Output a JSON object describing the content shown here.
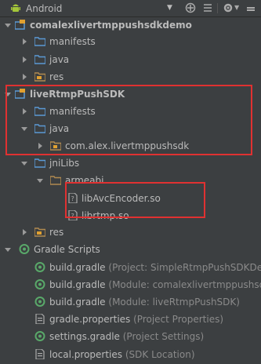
{
  "toolbar": {
    "view_label": "Android",
    "view_icon": "android-icon",
    "icons": [
      "sync-icon",
      "collapse-all-icon",
      "settings-icon",
      "hide-panel-icon"
    ]
  },
  "tree": {
    "rows": [
      {
        "label": "comalexlivertmppushsdkdemo",
        "hint": "",
        "bold": true,
        "icon": "module-icon"
      },
      {
        "label": "manifests",
        "hint": "",
        "icon": "folder-icon"
      },
      {
        "label": "java",
        "hint": "",
        "icon": "folder-icon"
      },
      {
        "label": "res",
        "hint": "",
        "icon": "res-folder-icon"
      },
      {
        "label": "liveRtmpPushSDK",
        "hint": "",
        "bold": true,
        "icon": "module-icon"
      },
      {
        "label": "manifests",
        "hint": "",
        "icon": "folder-icon"
      },
      {
        "label": "java",
        "hint": "",
        "icon": "folder-icon"
      },
      {
        "label": "com.alex.livertmppushsdk",
        "hint": "",
        "icon": "package-icon"
      },
      {
        "label": "jniLibs",
        "hint": "",
        "icon": "folder-icon"
      },
      {
        "label": "armeabi",
        "hint": "",
        "icon": "folder-icon"
      },
      {
        "label": "libAvcEncoder.so",
        "hint": "",
        "icon": "file-icon"
      },
      {
        "label": "librtmp.so",
        "hint": "",
        "icon": "file-icon"
      },
      {
        "label": "res",
        "hint": "",
        "icon": "res-folder-icon"
      },
      {
        "label": "Gradle Scripts",
        "hint": "",
        "icon": "gradle-icon"
      },
      {
        "label": "build.gradle",
        "hint": "(Project: SimpleRtmpPushSDKDem",
        "icon": "gradle-file-icon"
      },
      {
        "label": "build.gradle",
        "hint": "(Module: comalexlivertmppushsd",
        "icon": "gradle-file-icon"
      },
      {
        "label": "build.gradle",
        "hint": "(Module: liveRtmpPushSDK)",
        "icon": "gradle-file-icon"
      },
      {
        "label": "gradle.properties",
        "hint": "(Project Properties)",
        "icon": "properties-file-icon"
      },
      {
        "label": "settings.gradle",
        "hint": "(Project Settings)",
        "icon": "gradle-file-icon"
      },
      {
        "label": "local.properties",
        "hint": "(SDK Location)",
        "icon": "properties-file-icon"
      }
    ]
  },
  "colors": {
    "background": "#3c3f41",
    "text": "#bbbbbb",
    "hint": "#8a8a8a",
    "folder": "#5b9ad6",
    "highlight": "#e03131"
  }
}
